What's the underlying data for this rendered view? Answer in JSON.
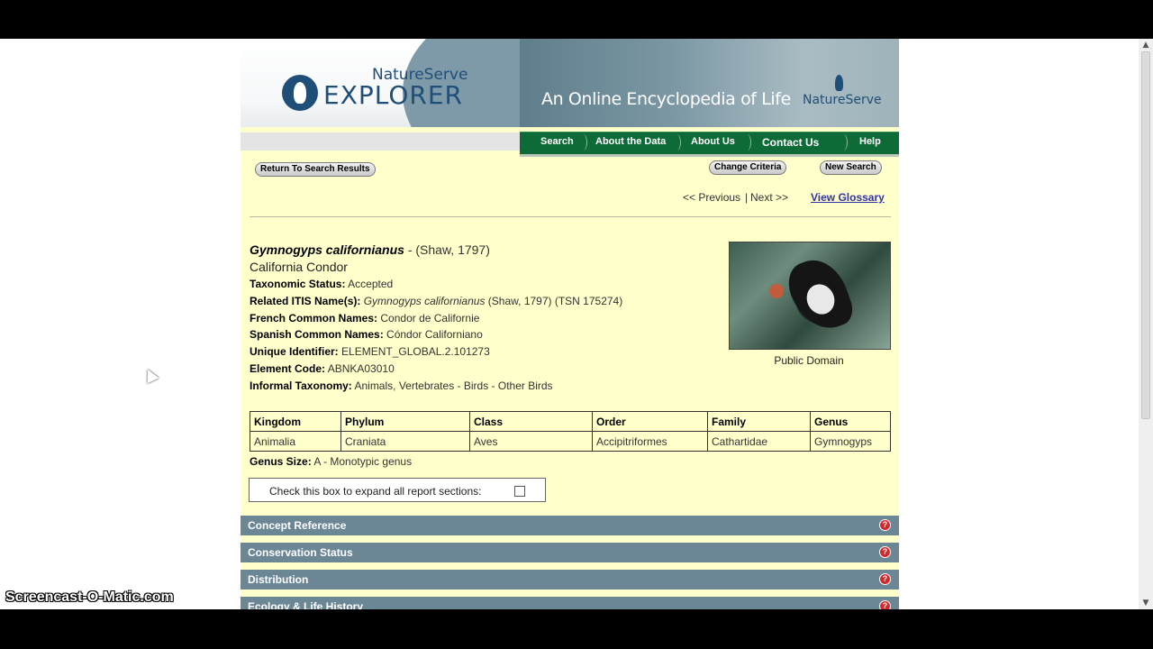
{
  "header": {
    "brand_small": "NatureServe",
    "brand_big": "EXPLORER",
    "tagline": "An Online Encyclopedia of Life",
    "org": "NatureServe"
  },
  "nav": {
    "search": "Search",
    "about_data": "About the Data",
    "about_us": "About Us",
    "contact": "Contact Us",
    "help": "Help"
  },
  "buttons": {
    "return": "Return To Search Results",
    "change": "Change Criteria",
    "new": "New Search"
  },
  "pager": {
    "previous": "<< Previous",
    "divider": "|",
    "next": "Next >>",
    "glossary": "View Glossary"
  },
  "species": {
    "scientific": "Gymnogyps californianus",
    "author": "- (Shaw, 1797)",
    "common": "California Condor",
    "fields": [
      {
        "label": "Taxonomic Status:",
        "value": "Accepted"
      },
      {
        "label": "Related ITIS Name(s):",
        "value_italic": "Gymnogyps californianus",
        "value": "(Shaw, 1797) (TSN 175274)"
      },
      {
        "label": "French Common Names:",
        "value": "Condor de Californie"
      },
      {
        "label": "Spanish Common Names:",
        "value": "Cóndor Californiano"
      },
      {
        "label": "Unique Identifier:",
        "value": "ELEMENT_GLOBAL.2.101273"
      },
      {
        "label": "Element Code:",
        "value": "ABNKA03010"
      },
      {
        "label": "Informal Taxonomy:",
        "value": "Animals, Vertebrates - Birds - Other Birds"
      }
    ],
    "photo_caption": "Public Domain"
  },
  "taxonomy": {
    "headers": [
      "Kingdom",
      "Phylum",
      "Class",
      "Order",
      "Family",
      "Genus"
    ],
    "values": [
      "Animalia",
      "Craniata",
      "Aves",
      "Accipitriformes",
      "Cathartidae",
      "Gymnogyps"
    ]
  },
  "genus_size": {
    "label": "Genus Size:",
    "value": "A - Monotypic genus"
  },
  "expand_label": "Check this box to expand all report sections:",
  "sections": [
    "Concept Reference",
    "Conservation Status",
    "Distribution",
    "Ecology & Life History"
  ],
  "section_help_glyph": "?",
  "scroll": {
    "up": "▲",
    "down": "▼"
  },
  "watermark": "Screencast-O-Matic.com",
  "colors": {
    "page_bg": "#ffffcc",
    "nav_bg": "#0e6a36",
    "section_bg": "#6b8796",
    "link": "#3333aa"
  }
}
